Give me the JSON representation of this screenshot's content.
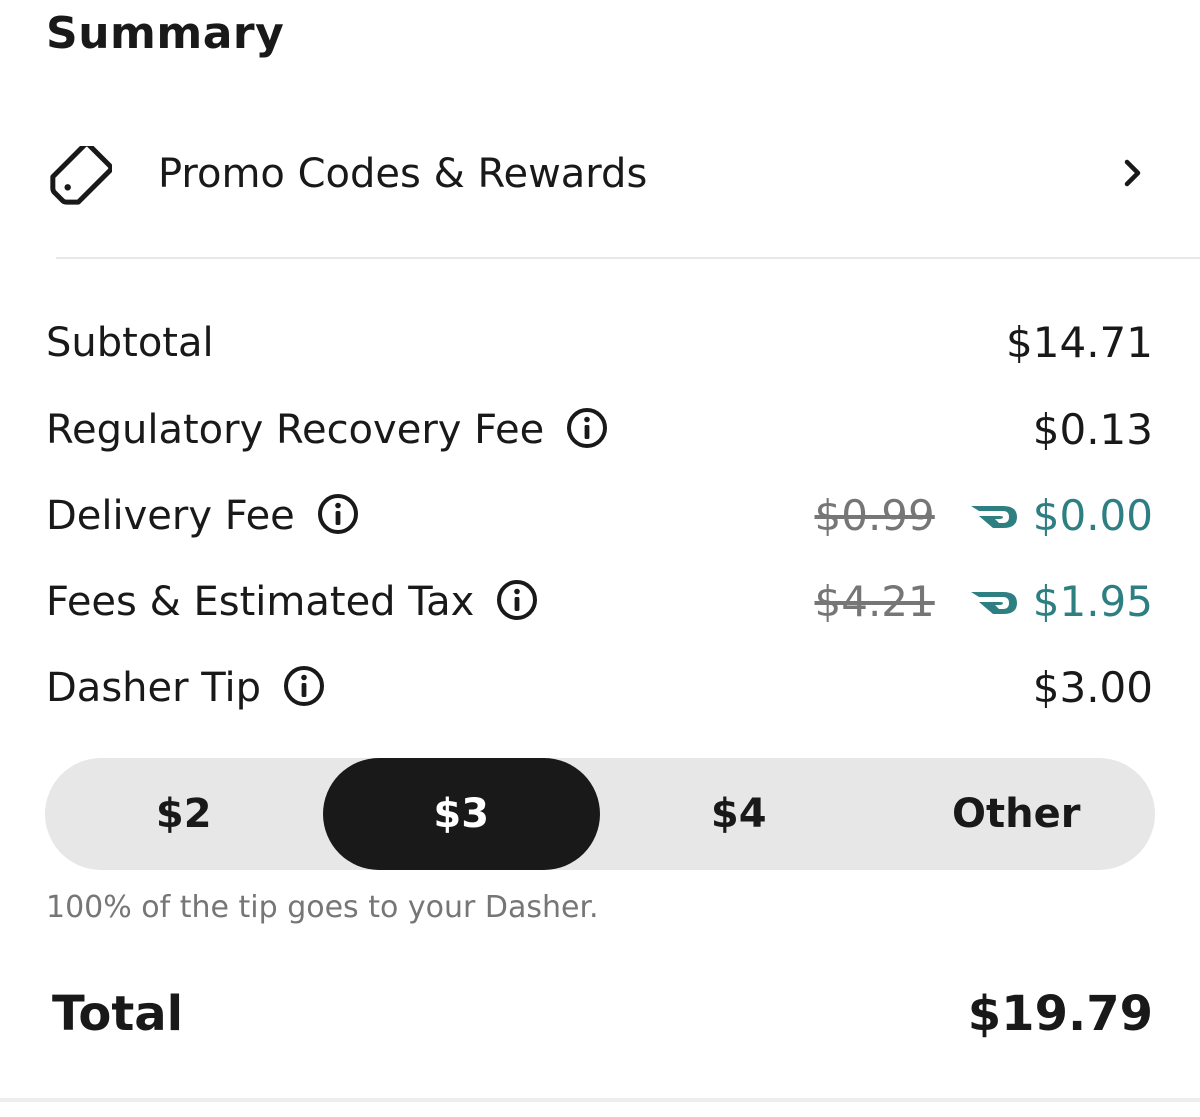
{
  "summary": {
    "title": "Summary"
  },
  "promo": {
    "icon": "tag-icon",
    "label": "Promo Codes & Rewards",
    "chevron": "chevron-right-icon"
  },
  "lines": {
    "subtotal": {
      "label": "Subtotal",
      "value": "$14.71"
    },
    "regulatory": {
      "label": "Regulatory Recovery Fee",
      "value": "$0.13",
      "has_info": true
    },
    "delivery": {
      "label": "Delivery Fee",
      "original": "$0.99",
      "value": "$0.00",
      "has_info": true,
      "discount_icon": "dashpass-icon"
    },
    "fees_tax": {
      "label": "Fees & Estimated Tax",
      "original": "$4.21",
      "value": "$1.95",
      "has_info": true,
      "discount_icon": "dashpass-icon"
    },
    "tip": {
      "label": "Dasher Tip",
      "value": "$3.00",
      "has_info": true
    }
  },
  "tip_options": {
    "options": [
      "$2",
      "$3",
      "$4",
      "Other"
    ],
    "selected": "$3",
    "note": "100% of the tip goes to your Dasher."
  },
  "total": {
    "label": "Total",
    "value": "$19.79"
  },
  "colors": {
    "text": "#191919",
    "muted": "#767676",
    "discount": "#2e7f82",
    "tip_bar_bg": "#e7e7e7",
    "selected_bg": "#191919"
  }
}
